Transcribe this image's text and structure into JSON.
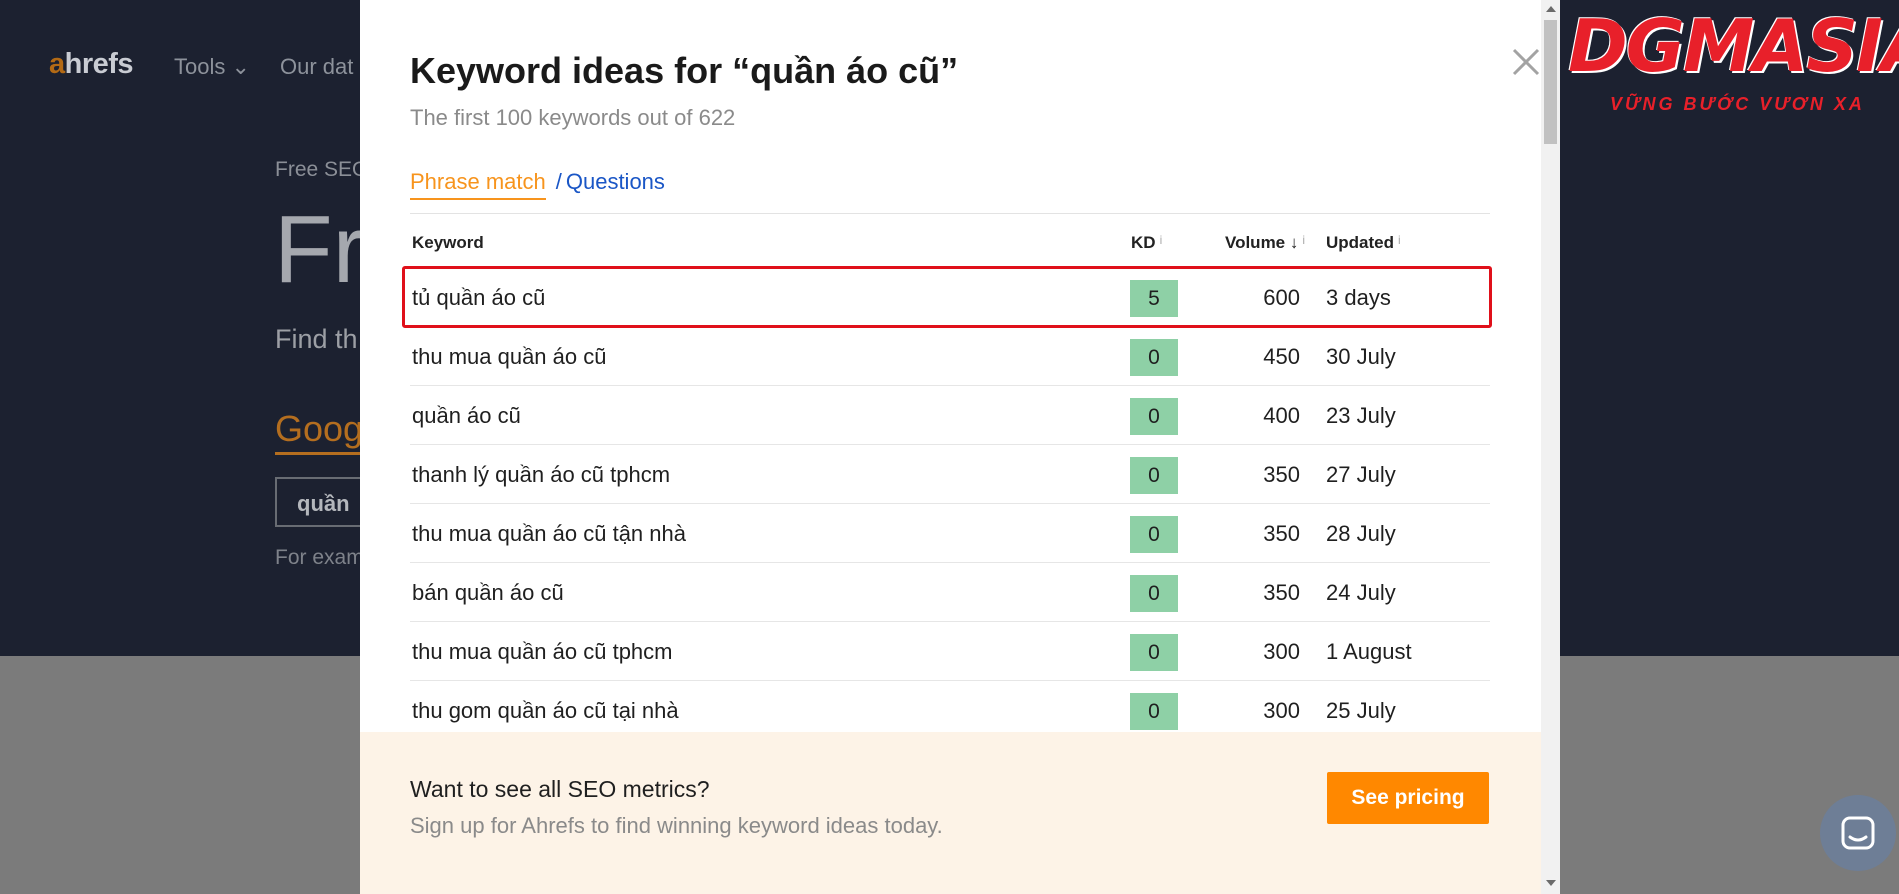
{
  "background": {
    "logo": {
      "accent": "a",
      "rest": "hrefs"
    },
    "nav_tools": "Tools ⌄",
    "nav_data": "Our dat",
    "eyebrow": "Free SEO",
    "hero": "Fr",
    "find": "Find th",
    "google": "Goog",
    "input_value": "quần",
    "example": "For exam"
  },
  "modal": {
    "title": "Keyword ideas for “quần áo cũ”",
    "subtitle": "The first 100 keywords out of 622",
    "tabs": {
      "phrase_match": "Phrase match",
      "separator": "/",
      "questions": "Questions"
    },
    "columns": {
      "keyword": "Keyword",
      "kd": "KD",
      "volume": "Volume ↓",
      "updated": "Updated",
      "info": "i"
    },
    "rows": [
      {
        "keyword": "tủ quần áo cũ",
        "kd": "5",
        "volume": "600",
        "updated": "3 days"
      },
      {
        "keyword": "thu mua quần áo cũ",
        "kd": "0",
        "volume": "450",
        "updated": "30 July"
      },
      {
        "keyword": "quần áo cũ",
        "kd": "0",
        "volume": "400",
        "updated": "23 July"
      },
      {
        "keyword": "thanh lý quần áo cũ tphcm",
        "kd": "0",
        "volume": "350",
        "updated": "27 July"
      },
      {
        "keyword": "thu mua quần áo cũ tận nhà",
        "kd": "0",
        "volume": "350",
        "updated": "28 July"
      },
      {
        "keyword": "bán quần áo cũ",
        "kd": "0",
        "volume": "350",
        "updated": "24 July"
      },
      {
        "keyword": "thu mua quần áo cũ tphcm",
        "kd": "0",
        "volume": "300",
        "updated": "1 August"
      },
      {
        "keyword": "thu gom quần áo cũ tại nhà",
        "kd": "0",
        "volume": "300",
        "updated": "25 July"
      }
    ],
    "footer": {
      "title": "Want to see all SEO metrics?",
      "subtitle": "Sign up for Ahrefs to find winning keyword ideas today.",
      "button": "See pricing"
    }
  },
  "watermark": {
    "name": "DGMASIA",
    "tagline": "VỮNG BƯỚC VƯƠN XA"
  },
  "icons": {
    "close": "close-icon",
    "chat": "chat-icon",
    "sort": "arrow-down"
  },
  "colors": {
    "accent": "#f7941d",
    "link": "#1a56c6",
    "kd_easy": "#8ed0a6",
    "button": "#ff8800",
    "highlight": "#e0101a",
    "footer_bg": "#fdf3e7"
  }
}
